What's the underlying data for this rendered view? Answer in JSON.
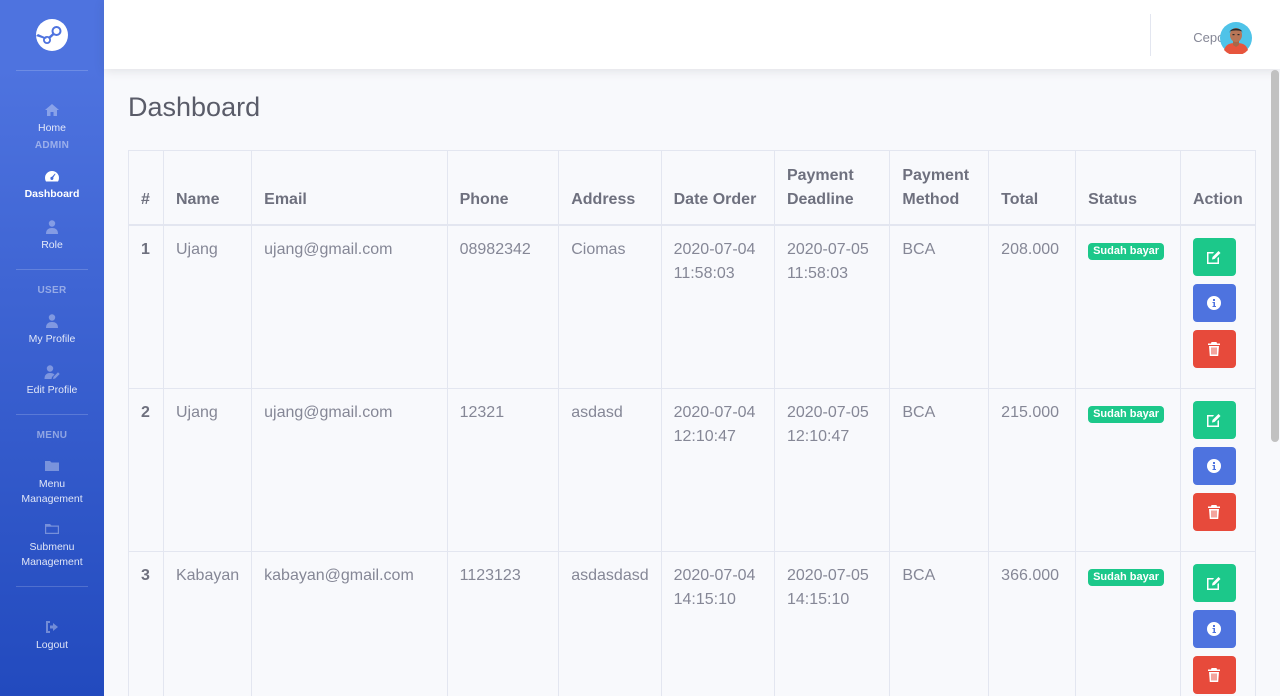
{
  "sidebar": {
    "sections": {
      "admin": "ADMIN",
      "user": "USER",
      "menu": "MENU"
    },
    "items": [
      {
        "label": "Home",
        "icon": "home-icon"
      },
      {
        "label": "Dashboard",
        "icon": "tachometer-icon",
        "active": true
      },
      {
        "label": "Role",
        "icon": "user-tie-icon"
      },
      {
        "label": "My Profile",
        "icon": "user-icon"
      },
      {
        "label": "Edit Profile",
        "icon": "user-edit-icon"
      },
      {
        "label": "Menu Management",
        "icon": "folder-icon"
      },
      {
        "label": "Submenu Management",
        "icon": "folder-open-icon"
      },
      {
        "label": "Logout",
        "icon": "sign-out-icon"
      }
    ]
  },
  "topbar": {
    "user_name": "Cepot"
  },
  "main": {
    "title": "Dashboard"
  },
  "table": {
    "headers": [
      "#",
      "Name",
      "Email",
      "Phone",
      "Address",
      "Date Order",
      "Payment Deadline",
      "Payment Method",
      "Total",
      "Status",
      "Action"
    ],
    "rows": [
      {
        "num": "1",
        "name": "Ujang",
        "email": "ujang@gmail.com",
        "phone": "08982342",
        "address": "Ciomas",
        "date_order": "2020-07-04 11:58:03",
        "deadline": "2020-07-05 11:58:03",
        "method": "BCA",
        "total": "208.000",
        "status": "Sudah bayar"
      },
      {
        "num": "2",
        "name": "Ujang",
        "email": "ujang@gmail.com",
        "phone": "12321",
        "address": "asdasd",
        "date_order": "2020-07-04 12:10:47",
        "deadline": "2020-07-05 12:10:47",
        "method": "BCA",
        "total": "215.000",
        "status": "Sudah bayar"
      },
      {
        "num": "3",
        "name": "Kabayan",
        "email": "kabayan@gmail.com",
        "phone": "1123123",
        "address": "asdasdasd",
        "date_order": "2020-07-04 14:15:10",
        "deadline": "2020-07-05 14:15:10",
        "method": "BCA",
        "total": "366.000",
        "status": "Sudah bayar"
      }
    ]
  },
  "colors": {
    "primary": "#4e73df",
    "success": "#1cc88a",
    "danger": "#e74a3b"
  }
}
